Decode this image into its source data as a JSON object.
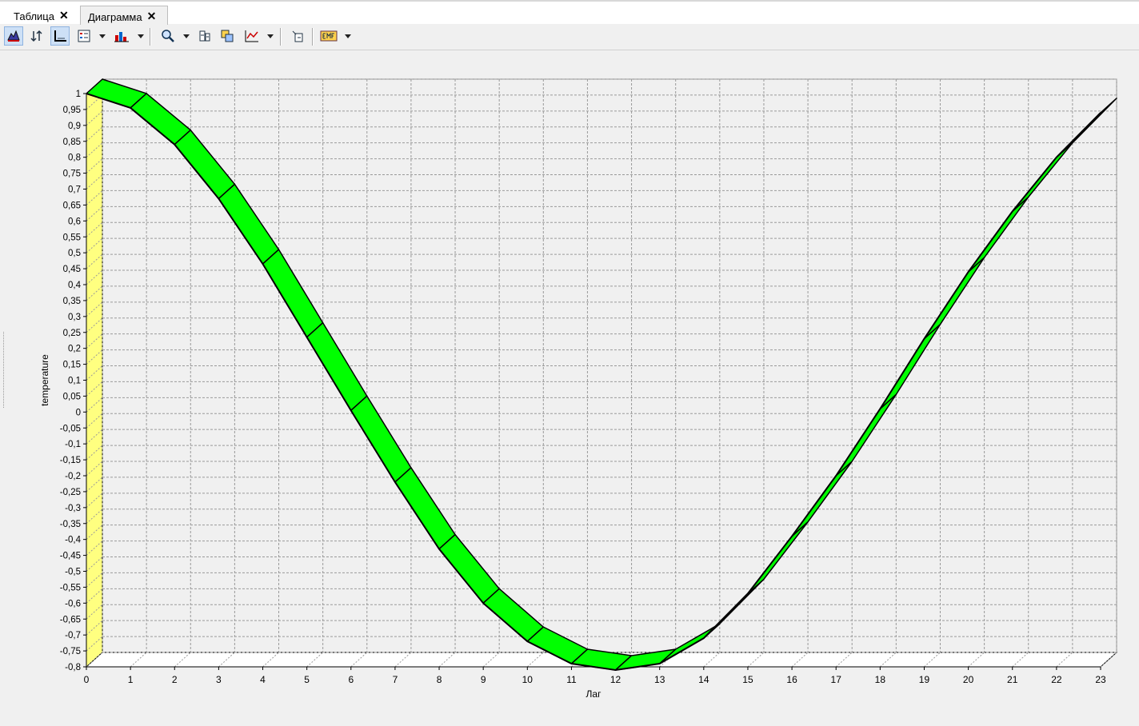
{
  "tabs": [
    {
      "label": "Таблица",
      "close": "✕"
    },
    {
      "label": "Диаграмма",
      "close": "✕"
    }
  ],
  "toolbar": {
    "icons": [
      "chart-3d-icon",
      "sort-icon",
      "axes-icon",
      "legend-icon",
      "chart-type-icon",
      "zoom-icon",
      "fit-icon",
      "copy-chart-icon",
      "line-chart-icon",
      "export-icon",
      "emf-icon"
    ]
  },
  "colors": {
    "series_fill": "#00ff00",
    "series_stroke": "#000000",
    "wall": "#ffff80",
    "background": "#f0f0f0"
  },
  "chart_data": {
    "type": "line",
    "style": "3d-ribbon",
    "xlabel": "Лаг",
    "ylabel": "temperature",
    "x": [
      0,
      1,
      2,
      3,
      4,
      5,
      6,
      7,
      8,
      9,
      10,
      11,
      12,
      13,
      14,
      15,
      16,
      17,
      18,
      19,
      20,
      21,
      22,
      23
    ],
    "x_tick_labels": [
      "0",
      "1",
      "2",
      "3",
      "4",
      "5",
      "6",
      "7",
      "8",
      "9",
      "10",
      "11",
      "12",
      "13",
      "14",
      "15",
      "16",
      "17",
      "18",
      "19",
      "20",
      "21",
      "22",
      "23"
    ],
    "series": [
      {
        "values": [
          1.0,
          0.955,
          0.84,
          0.67,
          0.465,
          0.235,
          0.005,
          -0.22,
          -0.43,
          -0.6,
          -0.72,
          -0.79,
          -0.81,
          -0.79,
          -0.71,
          -0.57,
          -0.39,
          -0.2,
          0.01,
          0.23,
          0.44,
          0.63,
          0.8,
          0.94
        ]
      }
    ],
    "ylim": [
      -0.8,
      1
    ],
    "xlim": [
      0,
      23
    ],
    "y_tick_step": 0.05,
    "y_tick_labels": [
      "1",
      "0,95",
      "0,9",
      "0,85",
      "0,8",
      "0,75",
      "0,7",
      "0,65",
      "0,6",
      "0,55",
      "0,5",
      "0,45",
      "0,4",
      "0,35",
      "0,3",
      "0,25",
      "0,2",
      "0,15",
      "0,1",
      "0,05",
      "0",
      "-0,05",
      "-0,1",
      "-0,15",
      "-0,2",
      "-0,25",
      "-0,3",
      "-0,35",
      "-0,4",
      "-0,45",
      "-0,5",
      "-0,55",
      "-0,6",
      "-0,65",
      "-0,7",
      "-0,75",
      "-0,8"
    ],
    "grid": true,
    "legend": "none"
  }
}
